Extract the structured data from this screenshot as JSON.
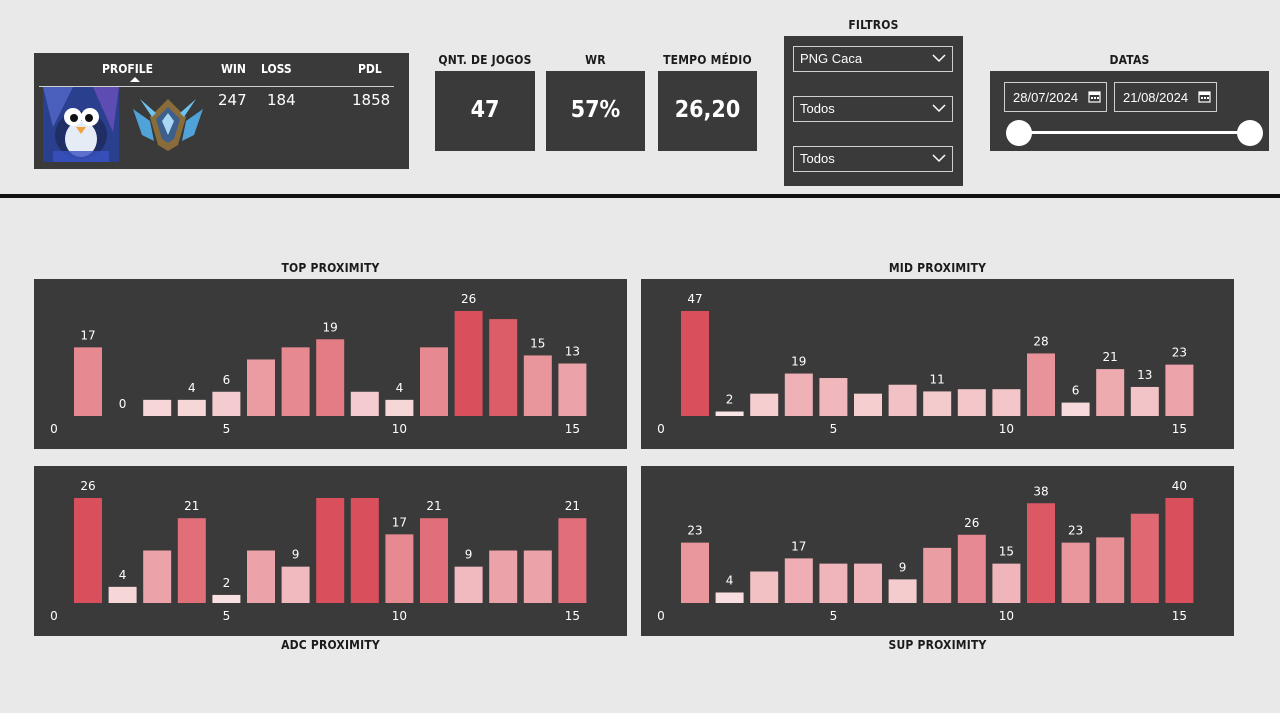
{
  "profile": {
    "headers": {
      "profile": "PROFILE",
      "win": "WIN",
      "loss": "LOSS",
      "pdl": "PDL"
    },
    "win": "247",
    "loss": "184",
    "pdl": "1858",
    "avatar_icon": "penguin-avatar-icon",
    "rank_icon": "diamond-rank-emblem-icon"
  },
  "kpis": [
    {
      "label": "QNT. DE JOGOS",
      "value": "47"
    },
    {
      "label": "WR",
      "value": "57%"
    },
    {
      "label": "TEMPO MÉDIO",
      "value": "26,20"
    }
  ],
  "filters": {
    "title": "FILTROS",
    "options": [
      "PNG Caca",
      "Todos",
      "Todos"
    ]
  },
  "dates": {
    "title": "DATAS",
    "start": "28/07/2024",
    "end": "21/08/2024"
  },
  "colors": {
    "panel": "#3a3a3a",
    "page": "#e9e9e9",
    "bar_high": "#d94f5c",
    "bar_low": "#fbeaea"
  },
  "chart_data": [
    {
      "type": "bar",
      "title": "TOP PROXIMITY",
      "x": [
        1,
        2,
        3,
        4,
        5,
        6,
        7,
        8,
        9,
        10,
        11,
        12,
        13,
        14,
        15
      ],
      "values": [
        17,
        0,
        4,
        4,
        6,
        14,
        17,
        19,
        6,
        4,
        17,
        26,
        24,
        15,
        13
      ],
      "data_labels": {
        "1": "17",
        "2": "0",
        "4": "4",
        "5": "6",
        "8": "19",
        "10": "4",
        "12": "26",
        "14": "15",
        "15": "13"
      },
      "xticks": [
        "0",
        "5",
        "10",
        "15"
      ],
      "xlim": [
        0,
        15
      ]
    },
    {
      "type": "bar",
      "title": "MID PROXIMITY",
      "x": [
        1,
        2,
        3,
        4,
        5,
        6,
        7,
        8,
        9,
        10,
        11,
        12,
        13,
        14,
        15
      ],
      "values": [
        47,
        2,
        10,
        19,
        17,
        10,
        14,
        11,
        12,
        12,
        28,
        6,
        21,
        13,
        23
      ],
      "data_labels": {
        "1": "47",
        "2": "2",
        "4": "19",
        "8": "11",
        "11": "28",
        "12": "6",
        "13": "21",
        "14": "13",
        "15": "23"
      },
      "xticks": [
        "0",
        "5",
        "10",
        "15"
      ],
      "xlim": [
        0,
        15
      ]
    },
    {
      "type": "bar",
      "title": "ADC PROXIMITY",
      "x": [
        1,
        2,
        3,
        4,
        5,
        6,
        7,
        8,
        9,
        10,
        11,
        12,
        13,
        14,
        15
      ],
      "values": [
        26,
        4,
        13,
        21,
        2,
        13,
        9,
        26,
        26,
        17,
        21,
        9,
        13,
        13,
        21
      ],
      "data_labels": {
        "1": "26",
        "2": "4",
        "4": "21",
        "5": "2",
        "7": "9",
        "10": "17",
        "11": "21",
        "12": "9",
        "15": "21"
      },
      "xticks": [
        "0",
        "5",
        "10",
        "15"
      ],
      "xlim": [
        0,
        15
      ]
    },
    {
      "type": "bar",
      "title": "SUP PROXIMITY",
      "x": [
        1,
        2,
        3,
        4,
        5,
        6,
        7,
        8,
        9,
        10,
        11,
        12,
        13,
        14,
        15
      ],
      "values": [
        23,
        4,
        12,
        17,
        15,
        15,
        9,
        21,
        26,
        15,
        38,
        23,
        25,
        34,
        40
      ],
      "data_labels": {
        "1": "23",
        "2": "4",
        "4": "17",
        "7": "9",
        "9": "26",
        "10": "15",
        "11": "38",
        "12": "23",
        "15": "40"
      },
      "xticks": [
        "0",
        "5",
        "10",
        "15"
      ],
      "xlim": [
        0,
        15
      ]
    }
  ]
}
